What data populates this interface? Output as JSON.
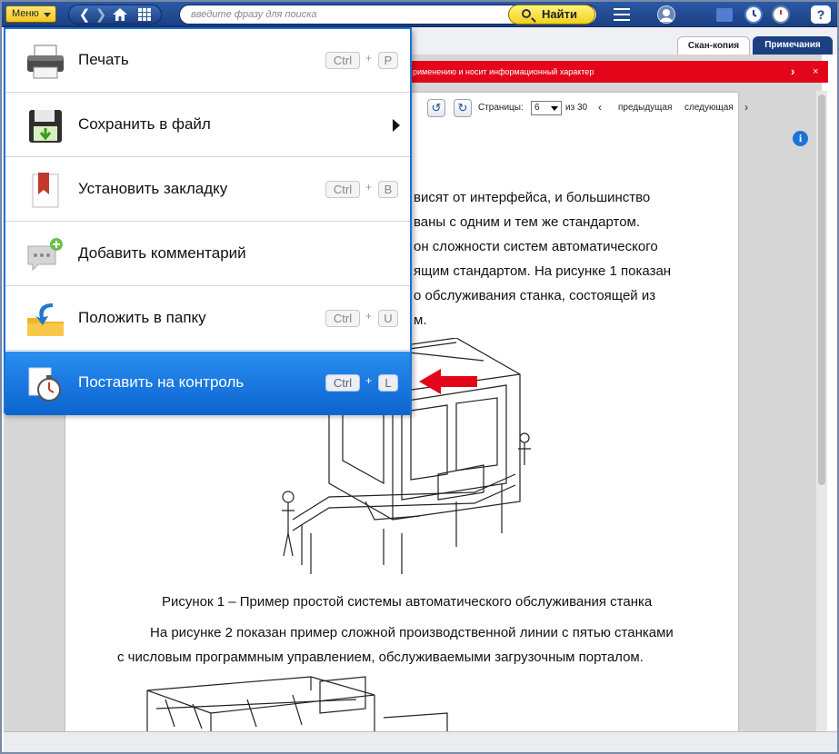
{
  "toolbar": {
    "menu_label": "Меню",
    "search_placeholder": "введите фразу для поиска",
    "find_label": "Найти",
    "colors": {
      "bar": "#1c3f82",
      "accent_yellow": "#f2c61c"
    }
  },
  "tabs": [
    {
      "label": "Скан-копия"
    },
    {
      "label": "Примечания"
    }
  ],
  "notice": {
    "text": "рименению и носит информационный характер",
    "next": "›",
    "close": "×"
  },
  "pagebar": {
    "pages_label": "Страницы:",
    "current_page": "6",
    "of_label": "из 30",
    "prev_label": "предыдущая",
    "next_label": "следующая"
  },
  "document": {
    "lines": [
      "висят  от  интерфейса,  и  большинство",
      "ваны с одним и тем же стандартом.",
      "он  сложности  систем  автоматического",
      "ящим стандартом. На рисунке 1 показан",
      "о  обслуживания  станка,  состоящей  из",
      "м."
    ],
    "caption": "Рисунок 1 – Пример простой системы автоматического обслуживания станка",
    "para2_line1": "На рисунке 2 показан пример сложной производственной линии с пятью станками",
    "para2_line2": "с числовым программным управлением, обслуживаемыми загрузочным порталом."
  },
  "menu": {
    "items": [
      {
        "label": "Печать",
        "ctrl": "Ctrl",
        "plus": "+",
        "key": "P",
        "icon": "printer-icon"
      },
      {
        "label": "Сохранить в файл",
        "icon": "save-file-icon"
      },
      {
        "label": "Установить закладку",
        "ctrl": "Ctrl",
        "plus": "+",
        "key": "B",
        "icon": "bookmark-icon"
      },
      {
        "label": "Добавить комментарий",
        "icon": "comment-add-icon"
      },
      {
        "label": "Положить в папку",
        "ctrl": "Ctrl",
        "plus": "+",
        "key": "U",
        "icon": "folder-put-icon"
      },
      {
        "label": "Поставить на контроль",
        "ctrl": "Ctrl",
        "plus": "+",
        "key": "L",
        "icon": "stopwatch-icon"
      }
    ]
  }
}
